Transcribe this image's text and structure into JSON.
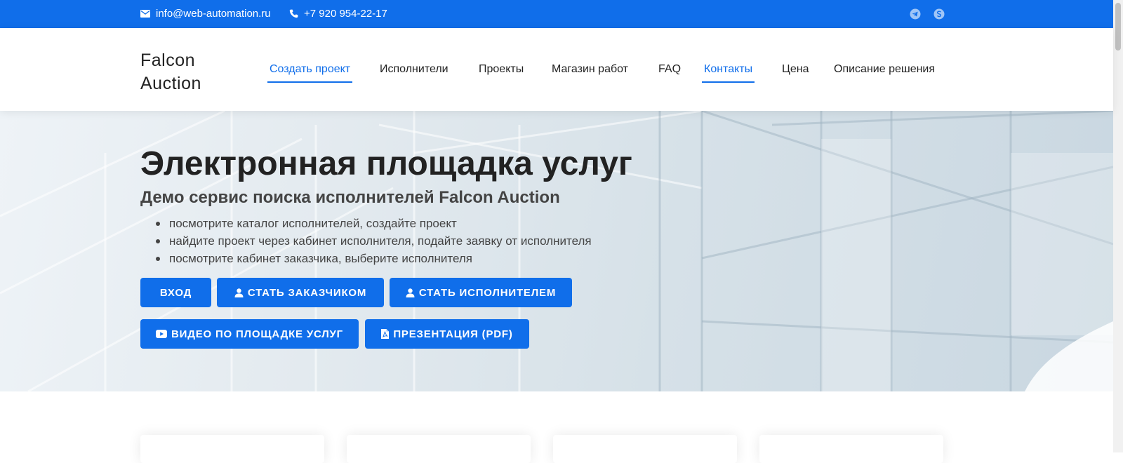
{
  "topbar": {
    "email": "info@web-automation.ru",
    "phone": "+7 920 954-22-17",
    "icons": [
      "envelope-icon",
      "phone-icon",
      "telegram-icon",
      "skype-icon"
    ]
  },
  "header": {
    "logo": "Falcon Auction",
    "nav": [
      {
        "label": "Создать проект",
        "active": true
      },
      {
        "label": "Исполнители",
        "active": false
      },
      {
        "label": "Проекты",
        "active": false
      },
      {
        "label": "Магазин работ",
        "active": false
      },
      {
        "label": "FAQ",
        "active": false
      },
      {
        "label": "Контакты",
        "active": true
      },
      {
        "label": "Цена",
        "active": false
      },
      {
        "label": "Описание решения",
        "active": false
      }
    ]
  },
  "hero": {
    "title": "Электронная площадка услуг",
    "subtitle": "Демо сервис поиска исполнителей Falcon Auction",
    "bullets": [
      "посмотрите каталог исполнителей, создайте проект",
      "найдите проект через кабинет исполнителя, подайте заявку от исполнителя",
      "посмотрите кабинет заказчика, выберите исполнителя"
    ],
    "buttons": {
      "login": "ВХОД",
      "become_customer": "СТАТЬ ЗАКАЗЧИКОМ",
      "become_executor": "СТАТЬ ИСПОЛНИТЕЛЕМ",
      "video": "ВИДЕО ПО ПЛОЩАДКЕ УСЛУГ",
      "presentation": "ПРЕЗЕНТАЦИЯ (PDF)"
    }
  },
  "colors": {
    "accent": "#106eea",
    "text_dark": "#222222",
    "text_muted": "#444444"
  }
}
